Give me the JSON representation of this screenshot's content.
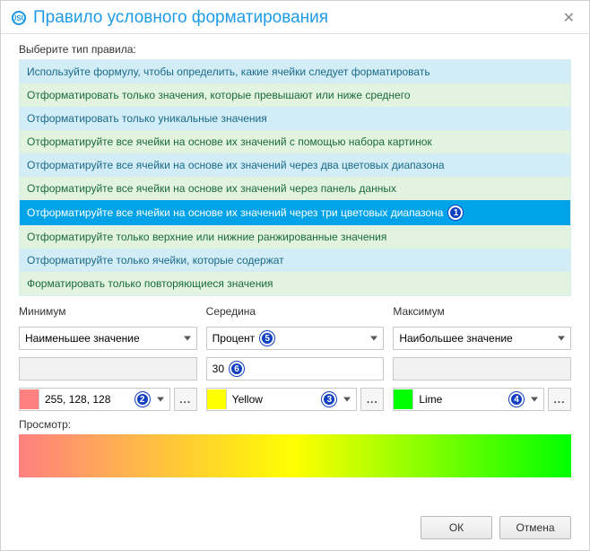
{
  "window": {
    "title": "Правило условного форматирования",
    "logo_text": "USU"
  },
  "choose_label": "Выберите тип правила:",
  "rules": [
    "Используйте формулу, чтобы определить, какие ячейки следует форматировать",
    "Отформатировать только значения, которые превышают или ниже среднего",
    "Отформатировать только уникальные значения",
    "Отформатируйте все ячейки на основе их значений с помощью набора картинок",
    "Отформатируйте все ячейки на основе их значений через два цветовых диапазона",
    "Отформатируйте все ячейки на основе их значений через панель данных",
    "Отформатируйте все ячейки на основе их значений через три цветовых диапазона",
    "Отформатируйте только верхние или нижние ранжированные значения",
    "Отформатируйте только ячейки, которые содержат",
    "Форматировать только повторяющиеся значения"
  ],
  "selected_rule_index": 6,
  "columns": {
    "min": {
      "label": "Минимум",
      "type": "Наименьшее значение",
      "value": "",
      "color_name": "255, 128, 128",
      "color_hex": "#ff8080"
    },
    "mid": {
      "label": "Середина",
      "type": "Процент",
      "value": "30",
      "color_name": "Yellow",
      "color_hex": "#ffff00"
    },
    "max": {
      "label": "Максимум",
      "type": "Наибольшее значение",
      "value": "",
      "color_name": "Lime",
      "color_hex": "#00ff00"
    }
  },
  "preview_label": "Просмотр:",
  "buttons": {
    "ok": "ОК",
    "cancel": "Отмена"
  },
  "markers": {
    "m1": "1",
    "m2": "2",
    "m3": "3",
    "m4": "4",
    "m5": "5",
    "m6": "6"
  },
  "dots": "..."
}
